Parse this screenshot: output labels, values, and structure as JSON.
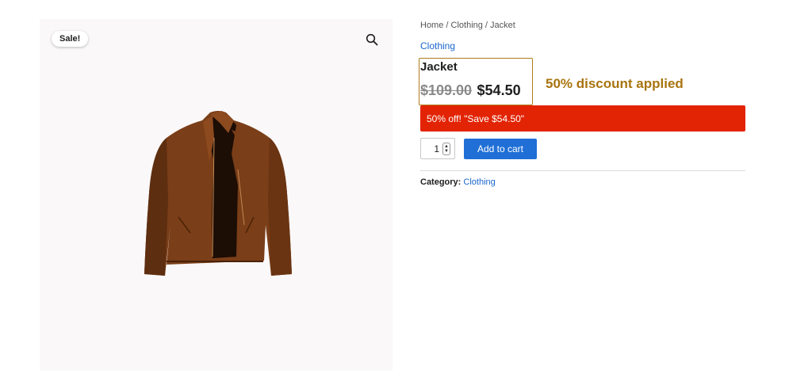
{
  "gallery": {
    "sale_badge": "Sale!",
    "zoom_icon": "magnifier-icon",
    "image_subject": "brown-leather-jacket"
  },
  "breadcrumb": {
    "items": [
      "Home",
      "Clothing",
      "Jacket"
    ],
    "separator": " / "
  },
  "product": {
    "category_link": "Clothing",
    "title": "Jacket",
    "price_old": "$109.00",
    "price_new": "$54.50",
    "discount_note": "50% discount applied",
    "sale_banner": "50% off! \"Save $54.50\"",
    "quantity": "1",
    "add_to_cart_label": "Add to cart",
    "meta_label": "Category:",
    "meta_value": "Clothing"
  },
  "colors": {
    "banner": "#e22405",
    "button": "#1f6fd6",
    "link": "#1a66cc",
    "discount_note": "#a8740f",
    "highlight_border": "#b07a1a"
  }
}
